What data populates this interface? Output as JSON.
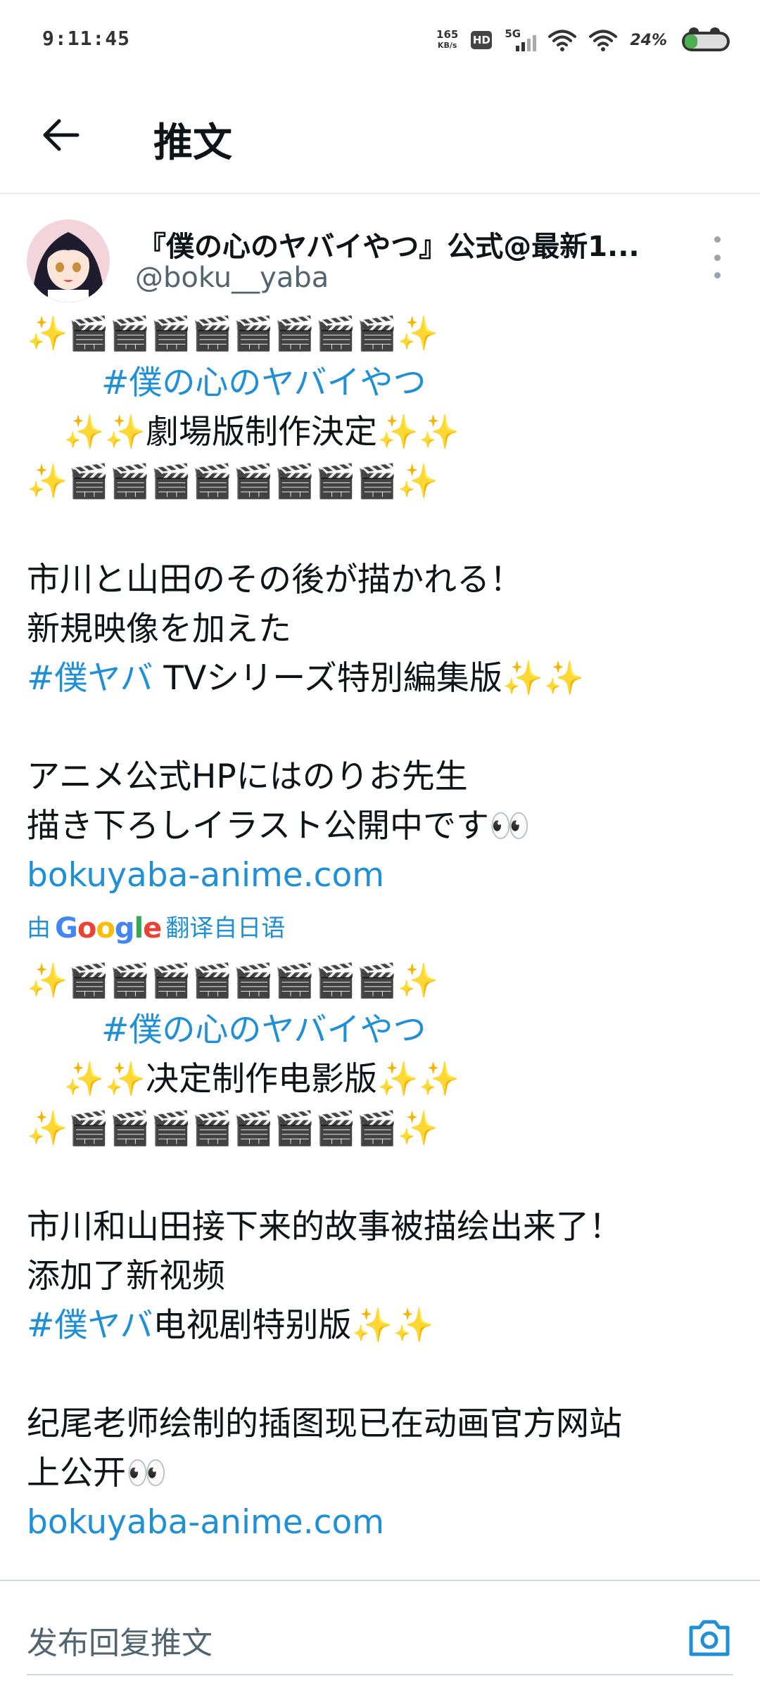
{
  "status_bar": {
    "time": "9:11:45",
    "net_speed_value": "165",
    "net_speed_unit": "KB/s",
    "hd_label": "HD",
    "network_label": "5G",
    "battery_percent": "24%"
  },
  "header": {
    "title": "推文"
  },
  "tweet": {
    "display_name": "『僕の心のヤバイやつ』公式@最新1...",
    "handle": "@boku__yaba",
    "lines": {
      "l1": "✨🎬🎬🎬🎬🎬🎬🎬🎬✨",
      "l2_hashtag": "#僕の心のヤバイやつ",
      "l3": "✨✨劇場版制作決定✨✨",
      "l4": "✨🎬🎬🎬🎬🎬🎬🎬🎬✨",
      "l5": "市川と山田のその後が描かれる！",
      "l6": "新規映像を加えた",
      "l7_hashtag": "#僕ヤバ",
      "l7_text": " TVシリーズ特別編集版✨✨",
      "l8": "アニメ公式HPにはのりお先生",
      "l9": "描き下ろしイラスト公開中です👀",
      "l10_link": "bokuyaba-anime.com"
    },
    "translation": {
      "prefix": "由",
      "suffix": "翻译自日语"
    },
    "translated_lines": {
      "t1": "✨🎬🎬🎬🎬🎬🎬🎬🎬✨",
      "t2_hashtag": "#僕の心のヤバイやつ",
      "t3": "✨✨决定制作电影版✨✨",
      "t4": "✨🎬🎬🎬🎬🎬🎬🎬🎬✨",
      "t5": "市川和山田接下来的故事被描绘出来了！",
      "t6": "添加了新视频",
      "t7_hashtag": "#僕ヤバ",
      "t7_text": "电视剧特别版✨✨",
      "t8": "纪尾老师绘制的插图现已在动画官方网站",
      "t9": "上公开👀",
      "t10_link": "bokuyaba-anime.com"
    }
  },
  "reply": {
    "placeholder": "发布回复推文"
  },
  "colors": {
    "link": "#1f8fd6",
    "text": "#0f1419",
    "muted": "#536471",
    "divider": "#e6ecf0"
  },
  "icons": [
    "back-arrow-icon",
    "more-vertical-icon",
    "camera-icon",
    "wifi-icon",
    "battery-icon",
    "signal-icon"
  ]
}
